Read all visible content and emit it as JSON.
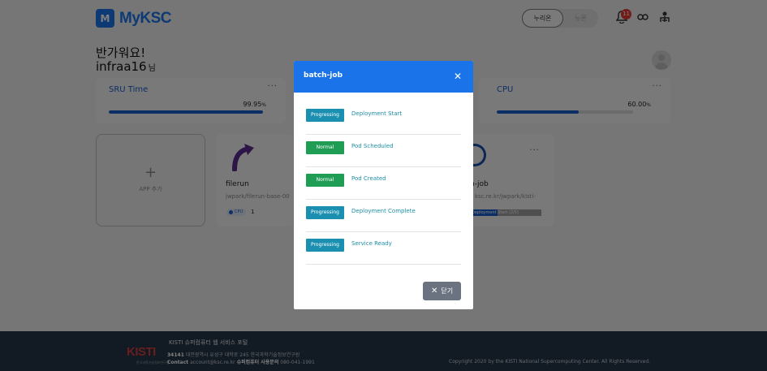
{
  "header": {
    "logo_mark": "M",
    "logo_text": "MyKSC",
    "segment": {
      "active_label": "누리온",
      "inactive_label": "뉴론"
    },
    "notification_count": "11",
    "icons": [
      "bell-icon",
      "link-icon",
      "user-network-icon"
    ]
  },
  "greeting": {
    "line1": "반가워요!",
    "username": "infraa16",
    "suffix": "님"
  },
  "metrics": [
    {
      "title": "SRU Time",
      "value": "99.95",
      "unit": "%",
      "fill": 0.9995
    },
    {
      "title": "CPU",
      "value": "60.00",
      "unit": "%",
      "fill": 0.6
    }
  ],
  "apps": {
    "add_label": "APP 추가",
    "filerun": {
      "name": "filerun",
      "image": "jwpark/filerun-base-00",
      "cpu_label": "CPU",
      "cpu_count": "1"
    },
    "batch": {
      "name": "h-job",
      "image": "ksc.re.kr/jwpark/kisti-",
      "progress_label": "Deployment Start (2/5)",
      "progress": 0.4
    }
  },
  "footer": {
    "logo": "KISTI",
    "logo_sub": "한국과학기술정보연구원",
    "title": "KISTI 슈퍼컴퓨터 웹 서비스 포털",
    "zip": "34141",
    "address": "대전광역시 유성구 대학로 245 한국과학기술정보연구원",
    "contact_label": "Contact",
    "email": "account@ksc.re.kr",
    "phone_label": "슈퍼컴퓨터 사용문의",
    "phone": "080-041-1991",
    "copyright": "Copyright 2020 by the KISTI National Supercomputing Center. All Rights Reserved."
  },
  "modal": {
    "title": "batch-job",
    "steps": [
      {
        "status": "Progressing",
        "label": "Deployment Start",
        "color": "#1a8fb0"
      },
      {
        "status": "Normal",
        "label": "Pod Scheduled",
        "color": "#1f9d55"
      },
      {
        "status": "Normal",
        "label": "Pod Created",
        "color": "#1f9d55"
      },
      {
        "status": "Progressing",
        "label": "Deployment Complete",
        "color": "#1a8fb0"
      },
      {
        "status": "Progressing",
        "label": "Service Ready",
        "color": "#1a8fb0"
      }
    ],
    "close_label": "닫기"
  },
  "colors": {
    "brand": "#1a73e8",
    "progressing": "#1a8fb0",
    "normal": "#1f9d55",
    "footer_bg": "#243447"
  }
}
